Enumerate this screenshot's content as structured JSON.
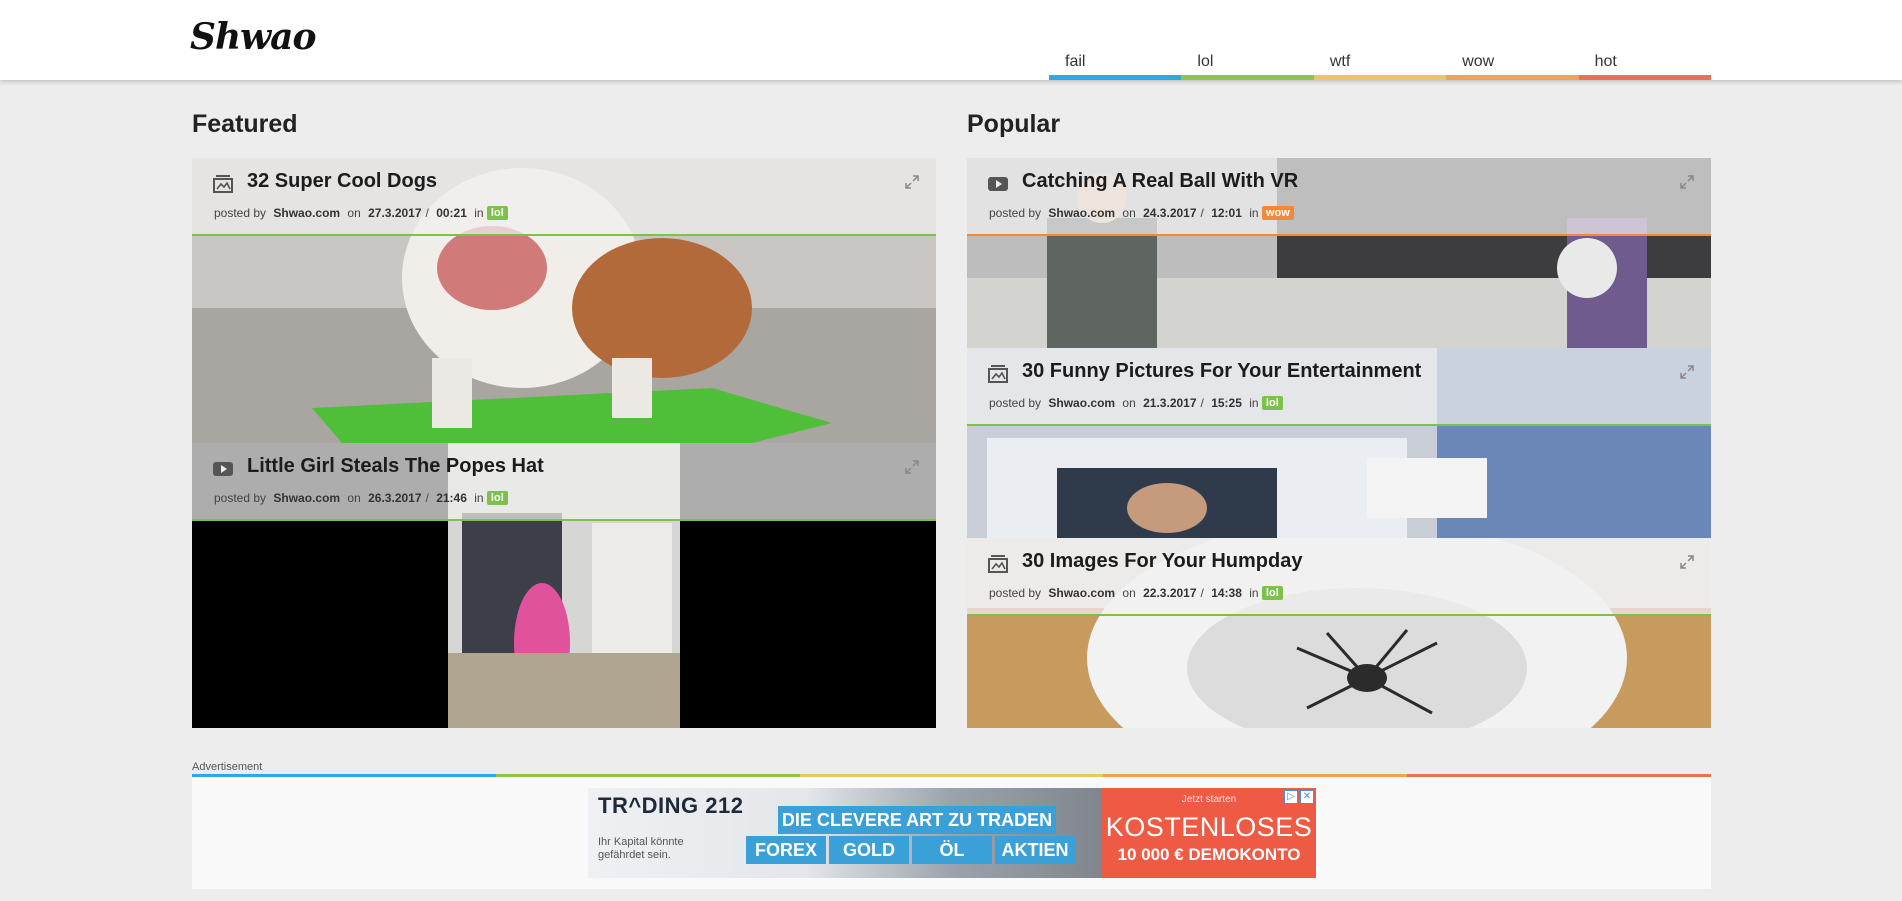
{
  "site": {
    "logo": "Shwao"
  },
  "nav": [
    {
      "label": "fail",
      "color": "#2ea8e5"
    },
    {
      "label": "lol",
      "color": "#8cc44f"
    },
    {
      "label": "wtf",
      "color": "#ecc56a"
    },
    {
      "label": "wow",
      "color": "#f2a15b"
    },
    {
      "label": "hot",
      "color": "#e8734f"
    }
  ],
  "featured": {
    "heading": "Featured",
    "cards": [
      {
        "title": "32 Super Cool Dogs",
        "type_icon": "gallery-icon",
        "posted_by_label": "posted by",
        "author": "Shwao.com",
        "on_label": "on",
        "date": "27.3.2017",
        "time": "00:21",
        "in_label": "in",
        "tag": "lol"
      },
      {
        "title": "Little Girl Steals The Popes Hat",
        "type_icon": "video-icon",
        "posted_by_label": "posted by",
        "author": "Shwao.com",
        "on_label": "on",
        "date": "26.3.2017",
        "time": "21:46",
        "in_label": "in",
        "tag": "lol"
      }
    ]
  },
  "popular": {
    "heading": "Popular",
    "cards": [
      {
        "title": "Catching A Real Ball With VR",
        "type_icon": "video-icon",
        "posted_by_label": "posted by",
        "author": "Shwao.com",
        "on_label": "on",
        "date": "24.3.2017",
        "time": "12:01",
        "in_label": "in",
        "tag": "wow"
      },
      {
        "title": "30 Funny Pictures For Your Entertainment",
        "type_icon": "gallery-icon",
        "posted_by_label": "posted by",
        "author": "Shwao.com",
        "on_label": "on",
        "date": "21.3.2017",
        "time": "15:25",
        "in_label": "in",
        "tag": "lol"
      },
      {
        "title": "30 Images For Your Humpday",
        "type_icon": "gallery-icon",
        "posted_by_label": "posted by",
        "author": "Shwao.com",
        "on_label": "on",
        "date": "22.3.2017",
        "time": "14:38",
        "in_label": "in",
        "tag": "lol"
      }
    ]
  },
  "advertisement": {
    "label": "Advertisement",
    "banner": {
      "brand": "TR^DING 212",
      "risk_note": "Ihr Kapital könnte gefährdet sein.",
      "headline": "DIE CLEVERE ART ZU TRADEN",
      "pills": [
        "FOREX",
        "GOLD",
        "ÖL",
        "AKTIEN"
      ],
      "cta_small": "Jetzt starten",
      "cta_big1": "KOSTENLOSES",
      "cta_big2": "10 000 € DEMOKONTO"
    }
  },
  "colors": {
    "lol": "#7cc24a",
    "wow": "#f08a3a"
  }
}
